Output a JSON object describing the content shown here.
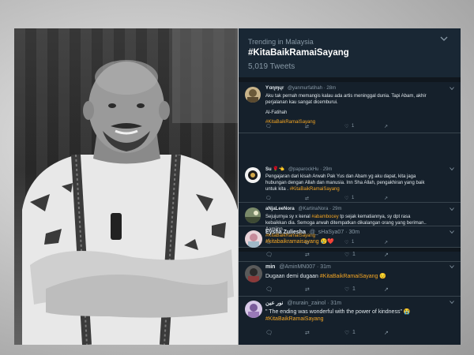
{
  "trend": {
    "location": "Trending in Malaysia",
    "hashtag": "#KitaBaikRamaiSayang",
    "count": "5,019 Tweets"
  },
  "tweets": [
    {
      "name": "Ƴɑɳɱɥr",
      "handle": "@yanmurfatihah · 28m",
      "lines": [
        "Aku tak pernah memangis kalau ada artis meninggal dunia. Tapi Abam, akhir",
        "perjalanan kau sangat dicemburui.",
        "",
        "Al-Fatihah"
      ],
      "hashtag": "#KitaBaikRamaiSayang",
      "likes": "1",
      "retweets": "",
      "replies": ""
    },
    {
      "name": "Su 🌹👈",
      "handle": "@paparockHu · 29m",
      "lines": [
        "Pengajaran dari kisah Arwah Pak Yus dan Abam yg aku dapat,  kita jaga",
        "hubungan dengan Allah dan manusia. Inn Sha Allah, pengakhiran yang baik"
      ],
      "lastline": "untuk kita . ",
      "hashtag": "#KitaBaikRamaiSayang",
      "likes": "1",
      "retweets": "",
      "replies": ""
    },
    {
      "name": "aNjaLeeNora",
      "handle": "@KartinaNora · 29m",
      "lines": [
        "Sejujurnya sy x kenal ",
        "tp sejak kematiannya, sy dpt rasa",
        "kebaikkan dia. Semoga arwah ditempatkan dikalangan orang yang beriman..",
        "Aamiinn"
      ],
      "mention": "#abambocey",
      "hashtag": "#KitaBaikRamaiSayang",
      "likes": "1",
      "retweets": "",
      "replies": ""
    },
    {
      "name": "Eysha Zuliesha",
      "handle": "@_sHaSya07 · 30m",
      "hashtag": "#kitabaikramaisayang",
      "emoji": "😢❤️",
      "likes": "1",
      "retweets": "",
      "replies": ""
    },
    {
      "name": "min",
      "handle": "@AminMN007 · 31m",
      "text": "Dugaan demi dugaan ",
      "hashtag": "#KitaBaikRamaiSayang",
      "emoji": "😔",
      "likes": "1",
      "retweets": "",
      "replies": ""
    },
    {
      "name": "نور عين",
      "handle": "@nurain_zainol · 31m",
      "text": "\" The ending was wonderful with the power of kindness\" 😭",
      "hashtag": "#KitaBaikRamaiSayang",
      "likes": "1",
      "retweets": "",
      "replies": ""
    }
  ],
  "colors": {
    "background": "#15202b",
    "header": "#192734",
    "hashtag": "#f5a623",
    "muted": "#8899a6",
    "text": "#e1e8ed"
  },
  "icons": {
    "reply": "reply-icon",
    "retweet": "retweet-icon",
    "like": "heart-icon",
    "share": "share-icon",
    "chevron": "chevron-down-icon"
  }
}
